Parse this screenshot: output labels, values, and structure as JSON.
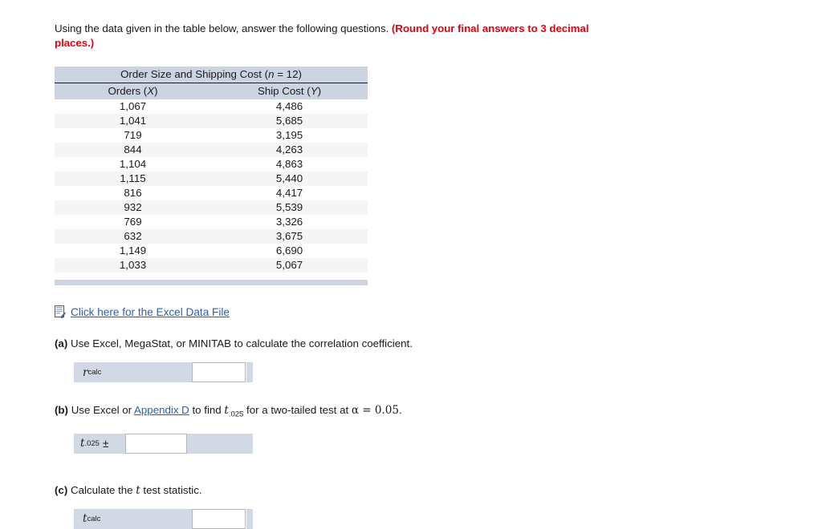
{
  "prompt": {
    "main": "Using the data given in the table below, answer the following questions.",
    "highlight": "(Round your final answers to 3 decimal places.)"
  },
  "table": {
    "title_text": "Order Size and Shipping Cost (",
    "title_n_var": "n",
    "title_n_value": " = 12)",
    "columns": [
      {
        "label": "Orders (",
        "var": "X",
        "close": ")"
      },
      {
        "label": "Ship Cost (",
        "var": "Y",
        "close": ")"
      }
    ],
    "column_headers": [
      "Orders (X)",
      "Ship Cost (Y)"
    ],
    "rows": [
      {
        "x": "1,067",
        "y": "4,486"
      },
      {
        "x": "1,041",
        "y": "5,685"
      },
      {
        "x": "719",
        "y": "3,195"
      },
      {
        "x": "844",
        "y": "4,263"
      },
      {
        "x": "1,104",
        "y": "4,863"
      },
      {
        "x": "1,115",
        "y": "5,440"
      },
      {
        "x": "816",
        "y": "4,417"
      },
      {
        "x": "932",
        "y": "5,539"
      },
      {
        "x": "769",
        "y": "3,326"
      },
      {
        "x": "632",
        "y": "3,675"
      },
      {
        "x": "1,149",
        "y": "6,690"
      },
      {
        "x": "1,033",
        "y": "5,067"
      }
    ]
  },
  "excel_link": {
    "icon": "excel-file-icon",
    "label": "Click here for the Excel Data File"
  },
  "parts": {
    "a": {
      "tag": "(a)",
      "text": "Use Excel, MegaStat, or MINITAB to calculate the correlation coefficient.",
      "answer": {
        "symbol": "r",
        "subscript": "calc",
        "value": "",
        "placeholder": ""
      }
    },
    "b": {
      "tag": "(b)",
      "text_before_link": "Use Excel or ",
      "link": "Appendix D",
      "text_after_link": " to find ",
      "t_symbol": "t",
      "t_subscript": ".025",
      "text_tail": " for a two-tailed test at ",
      "alpha_expr": "α = 0.05",
      "period": ".",
      "answer": {
        "symbol": "t",
        "subscript": ".025",
        "plusminus": "±",
        "value": "",
        "placeholder": ""
      }
    },
    "c": {
      "tag": "(c)",
      "text_before": "Calculate the ",
      "t_symbol": "t",
      "text_after": " test statistic.",
      "answer": {
        "symbol": "t",
        "subscript": "calc",
        "value": "",
        "placeholder": ""
      }
    }
  },
  "colors": {
    "header_bg": "#ccd4e1",
    "row_alt_bg": "#f5f5f6",
    "answer_label_bg": "#d3d9e4",
    "link_blue": "#2b5fb0",
    "highlight_red": "#e8000d"
  }
}
